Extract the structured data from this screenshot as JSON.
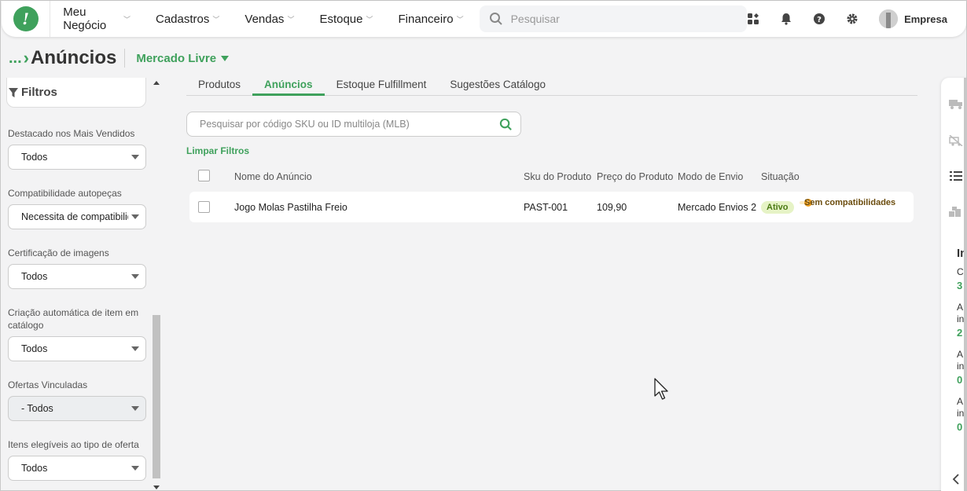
{
  "topbar": {
    "logo": "!",
    "nav": [
      "Meu Negócio",
      "Cadastros",
      "Vendas",
      "Estoque",
      "Financeiro"
    ],
    "search_placeholder": "Pesquisar",
    "company": "Empresa"
  },
  "header": {
    "dots": "...",
    "title": "Anúncios",
    "marketplace": "Mercado Livre"
  },
  "sidebar": {
    "title": "Filtros",
    "filters": [
      {
        "label": "Destacado nos Mais Vendidos",
        "value": "Todos",
        "disabled": false
      },
      {
        "label": "Compatibilidade autopeças",
        "value": "Necessita de compatibilidade",
        "disabled": false
      },
      {
        "label": "Certificação de imagens",
        "value": "Todos",
        "disabled": false
      },
      {
        "label": "Criação automática de item em catálogo",
        "value": "Todos",
        "disabled": false
      },
      {
        "label": "Ofertas Vinculadas",
        "value": "- Todos",
        "disabled": true
      },
      {
        "label": "Itens elegíveis ao tipo de oferta",
        "value": "Todos",
        "disabled": false
      }
    ]
  },
  "tabs": [
    "Produtos",
    "Anúncios",
    "Estoque Fulfillment",
    "Sugestões Catálogo"
  ],
  "active_tab": "Anúncios",
  "main": {
    "search_placeholder": "Pesquisar por código SKU ou ID multiloja (MLB)",
    "clear_filters": "Limpar Filtros",
    "columns": [
      "Nome do Anúncio",
      "Sku do Produto",
      "Preço do Produto",
      "Modo de Envio",
      "Situação"
    ],
    "rows": [
      {
        "name": "Jogo Molas Pastilha Freio",
        "sku": "PAST-001",
        "price": "109,90",
        "shipping": "Mercado Envios 2",
        "status": "Ativo",
        "warning": "Sem compatibilidades"
      }
    ]
  },
  "rightpanel": {
    "heading": "In",
    "items": [
      "C",
      "3",
      "A",
      "in",
      "2",
      "A",
      "in",
      "0",
      "A",
      "in",
      "0"
    ]
  },
  "colors": {
    "accent": "#3fa15c",
    "status_active_bg": "#e6f3c6",
    "warning_bg": "#fcebc5"
  }
}
